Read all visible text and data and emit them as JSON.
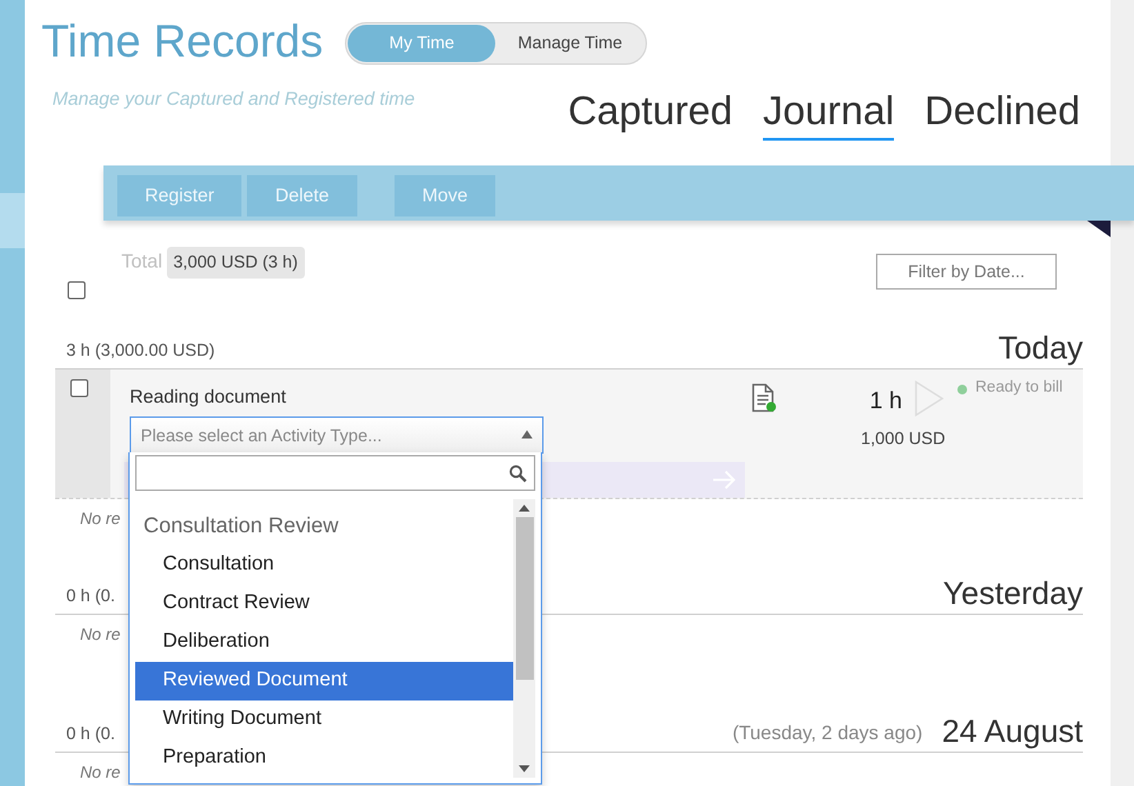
{
  "header": {
    "title": "Time Records",
    "subtitle": "Manage your Captured and Registered time",
    "view_toggle": [
      {
        "label": "My Time",
        "selected": true
      },
      {
        "label": "Manage Time",
        "selected": false
      }
    ]
  },
  "tabs": [
    {
      "label": "Captured",
      "selected": false
    },
    {
      "label": "Journal",
      "selected": true
    },
    {
      "label": "Declined",
      "selected": false
    }
  ],
  "toolbar": {
    "buttons": [
      "Register",
      "Delete",
      "Move"
    ]
  },
  "summary": {
    "label": "Total",
    "value": "3,000 USD (3 h)",
    "select_all_checked": false,
    "filter_button": "Filter by Date..."
  },
  "groups": [
    {
      "total": "3 h (3,000.00 USD)",
      "day": "Today",
      "records": [
        {
          "checked": false,
          "description": "Reading document",
          "hours": "1 h",
          "amount": "1,000 USD",
          "status": "Ready to bill",
          "color": "#8fcf9b",
          "activity_select": {
            "placeholder": "Please select an Activity Type...",
            "expanded": true
          }
        }
      ],
      "empty_text": "No re"
    },
    {
      "total": "0 h (0.",
      "day": "Yesterday",
      "empty_text": "No re"
    },
    {
      "total": "0 h (0.",
      "note": "(Tuesday, 2 days ago)",
      "day": "24 August",
      "empty_text": "No re"
    }
  ],
  "dropdown": {
    "group": "Consultation Review",
    "options": [
      {
        "label": "Consultation",
        "selected": false
      },
      {
        "label": "Contract Review",
        "selected": false
      },
      {
        "label": "Deliberation",
        "selected": false
      },
      {
        "label": "Reviewed Document",
        "selected": true
      },
      {
        "label": "Writing Document",
        "selected": false
      },
      {
        "label": "Preparation",
        "selected": false
      }
    ]
  }
}
